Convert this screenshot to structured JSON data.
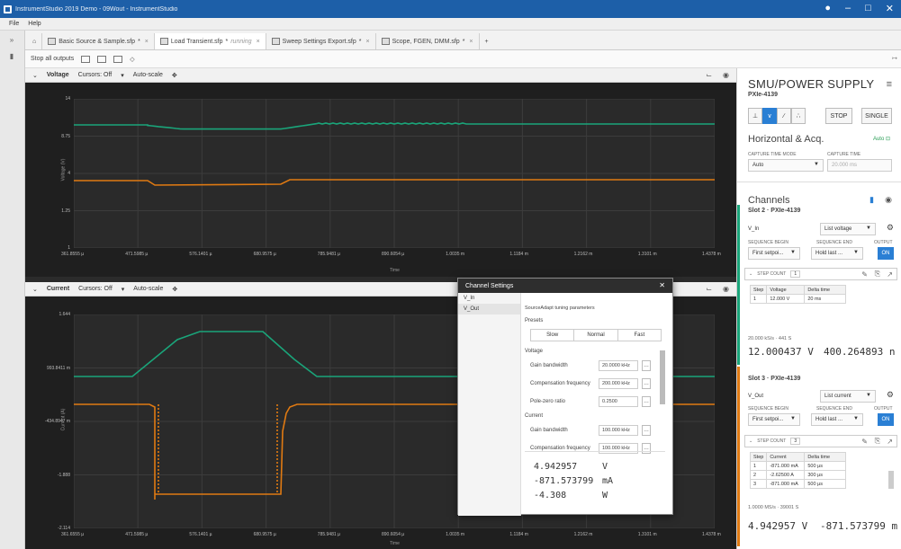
{
  "window": {
    "title": "InstrumentStudio 2019 Demo - 09Wout - InstrumentStudio",
    "controls": [
      "●",
      "–",
      "□",
      "✕"
    ]
  },
  "menu": [
    "File",
    "Help"
  ],
  "tabs": [
    {
      "label": "Basic Source & Sample.sfp",
      "suffix": "*",
      "active": false
    },
    {
      "label": "Load Transient.sfp",
      "suffix": "*",
      "status": "running",
      "active": true
    },
    {
      "label": "Sweep Settings Export.sfp",
      "suffix": "*",
      "active": false
    },
    {
      "label": "Scope, FGEN, DMM.sfp",
      "suffix": "*",
      "active": false
    }
  ],
  "tab_add": "+",
  "toolbar": {
    "stop_all": "Stop all outputs"
  },
  "voltage_graph": {
    "name": "Voltage",
    "cursors": "Cursors: Off",
    "autoscale": "Auto-scale",
    "y_ticks": [
      "14",
      "8.75",
      "4",
      "1.25",
      "1"
    ],
    "x_ticks": [
      "361.8555 µ",
      "471.5985 µ",
      "576.1401 µ",
      "680.9575 µ",
      "785.9481 µ",
      "890.6054 µ",
      "1.0035 m",
      "1.1184 m",
      "1.2162 m",
      "1.3101 m",
      "1.4378 m"
    ],
    "y_axis_title": "Voltage (V)",
    "x_axis_title": "Time"
  },
  "current_graph": {
    "name": "Current",
    "cursors": "Cursors: Off",
    "autoscale": "Auto-scale",
    "y_ticks": [
      "1.644",
      "993.8411 m",
      "-434.8947 m",
      "-1.888",
      "-2.114"
    ],
    "x_ticks": [
      "361.6555 µ",
      "471.5985 µ",
      "576.1401 µ",
      "680.9575 µ",
      "785.9481 µ",
      "890.6054 µ",
      "1.0035 m",
      "1.1184 m",
      "1.2162 m",
      "1.3101 m",
      "1.4378 m"
    ],
    "y_axis_title": "Current (A)",
    "x_axis_title": "Time"
  },
  "side_panel": {
    "title": "SMU/POWER SUPPLY",
    "device": "PXIe-4139",
    "stop": "STOP",
    "single": "SINGLE",
    "horizontal_title": "Horizontal & Acq.",
    "auto_label": "Auto",
    "capture_time_mode_label": "CAPTURE TIME MODE",
    "capture_time_mode": "Auto",
    "capture_time_label": "CAPTURE TIME",
    "capture_time": "20.000 ms",
    "channels_title": "Channels",
    "slot2": {
      "title": "Slot 2 · PXIe-4139",
      "channel": "V_In",
      "mode": "List voltage",
      "seq_begin_label": "SEQUENCE BEGIN",
      "seq_begin": "First setpoi...",
      "seq_end_label": "SEQUENCE END",
      "seq_end": "Hold last ...",
      "output_label": "OUTPUT",
      "output": "ON",
      "step_count_label": "STEP COUNT",
      "step_count": "1",
      "headers": [
        "Step",
        "Voltage",
        "Delta time"
      ],
      "rows": [
        [
          "1",
          "12.000 V",
          "20 ms"
        ]
      ],
      "rate": "20.000 kS/s · 441 S",
      "reading_v": "12.000437 V",
      "reading_i": "400.264893 n"
    },
    "slot3": {
      "title": "Slot 3 · PXIe-4139",
      "channel": "V_Out",
      "mode": "List current",
      "seq_begin_label": "SEQUENCE BEGIN",
      "seq_begin": "First setpoi...",
      "seq_end_label": "SEQUENCE END",
      "seq_end": "Hold last ...",
      "output_label": "OUTPUT",
      "output": "ON",
      "step_count_label": "STEP COUNT",
      "step_count": "3",
      "headers": [
        "Step",
        "Current",
        "Delta time"
      ],
      "rows": [
        [
          "1",
          "-871.000 mA",
          "500 µs"
        ],
        [
          "2",
          "-2.62500 A",
          "300 µs"
        ],
        [
          "3",
          "-871.000 mA",
          "500 µs"
        ]
      ],
      "rate": "1.0000 MS/s · 39001 S",
      "reading_v": "4.942957 V",
      "reading_i": "-871.573799 m"
    }
  },
  "dialog": {
    "title": "Channel Settings",
    "channels": [
      "V_In",
      "V_Out"
    ],
    "section": "SourceAdapt tuning parameters",
    "presets_label": "Presets",
    "presets": [
      "Slow",
      "Normal",
      "Fast"
    ],
    "voltage_label": "Voltage",
    "voltage_rows": [
      {
        "label": "Gain bandwidth",
        "value": "20.0000 kHz"
      },
      {
        "label": "Compensation frequency",
        "value": "200.000 kHz"
      },
      {
        "label": "Pole-zero ratio",
        "value": "0.2500"
      }
    ],
    "current_label": "Current",
    "current_rows": [
      {
        "label": "Gain bandwidth",
        "value": "100.000 kHz"
      },
      {
        "label": "Compensation frequency",
        "value": "100.000 kHz"
      }
    ],
    "readout_v": "4.942957",
    "readout_v_unit": "V",
    "readout_i": "-871.573799",
    "readout_i_unit": "mA",
    "readout_p": "-4.308",
    "readout_p_unit": "W"
  },
  "colors": {
    "voltage_trace_in": "#1aa57a",
    "voltage_trace_out": "#e07a12",
    "accent": "#2a7fd4"
  }
}
